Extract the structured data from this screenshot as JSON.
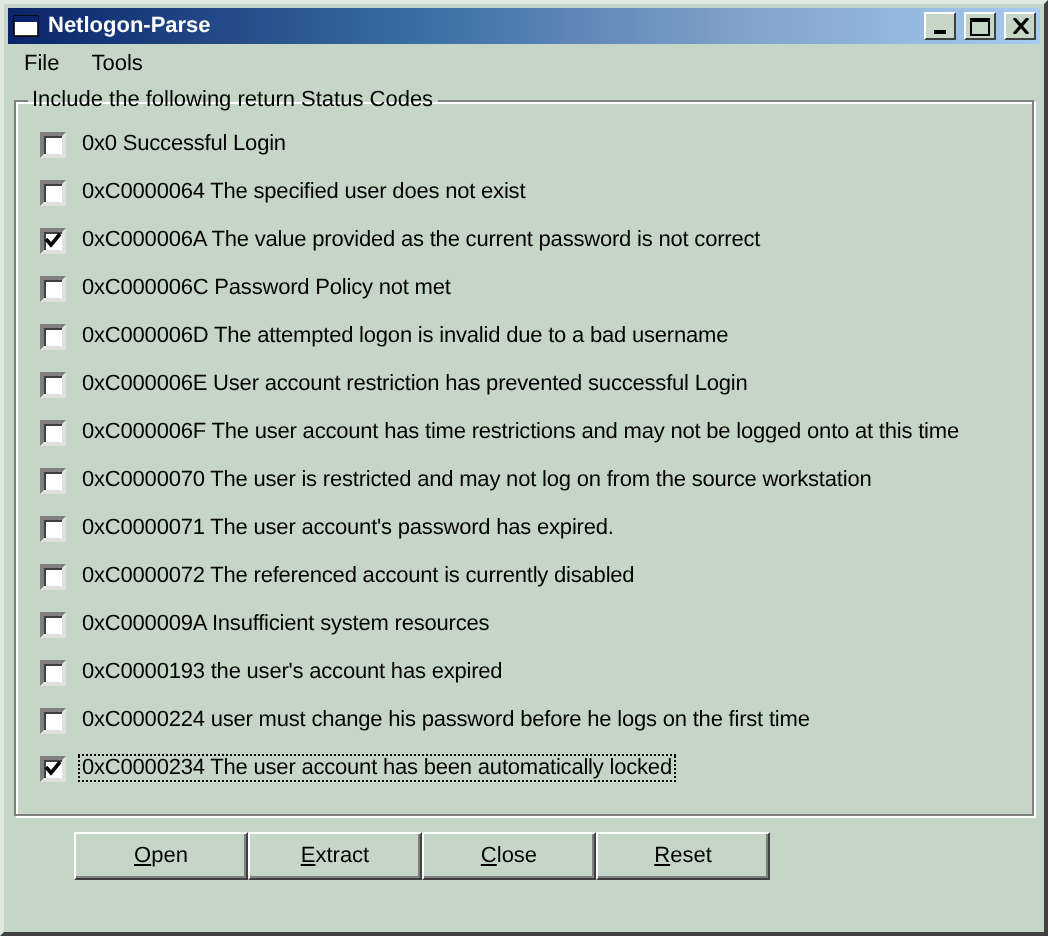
{
  "window": {
    "title": "Netlogon-Parse"
  },
  "menu": [
    "File",
    "Tools"
  ],
  "group": {
    "title": "Include the following return Status Codes",
    "items": [
      {
        "label": "0x0 Successful Login",
        "checked": false,
        "focused": false
      },
      {
        "label": "0xC0000064 The specified user does not exist",
        "checked": false,
        "focused": false
      },
      {
        "label": "0xC000006A The value provided as the current password is not correct",
        "checked": true,
        "focused": false
      },
      {
        "label": "0xC000006C Password Policy not met",
        "checked": false,
        "focused": false
      },
      {
        "label": "0xC000006D The attempted logon is invalid due to a bad username",
        "checked": false,
        "focused": false
      },
      {
        "label": "0xC000006E User account restriction has prevented successful Login",
        "checked": false,
        "focused": false
      },
      {
        "label": "0xC000006F The user account has time restrictions and may not be logged onto at this time",
        "checked": false,
        "focused": false
      },
      {
        "label": "0xC0000070 The user is restricted and may not log on from the source workstation",
        "checked": false,
        "focused": false
      },
      {
        "label": "0xC0000071 The user account's password has expired.",
        "checked": false,
        "focused": false
      },
      {
        "label": "0xC0000072 The referenced account is currently disabled",
        "checked": false,
        "focused": false
      },
      {
        "label": "0xC000009A Insufficient system resources",
        "checked": false,
        "focused": false
      },
      {
        "label": "0xC0000193 the user's account has expired",
        "checked": false,
        "focused": false
      },
      {
        "label": "0xC0000224 user must change his password before he logs on the first time",
        "checked": false,
        "focused": false
      },
      {
        "label": "0xC0000234 The user account has been automatically locked",
        "checked": true,
        "focused": true
      }
    ]
  },
  "buttons": [
    "Open",
    "Extract",
    "Close",
    "Reset"
  ]
}
